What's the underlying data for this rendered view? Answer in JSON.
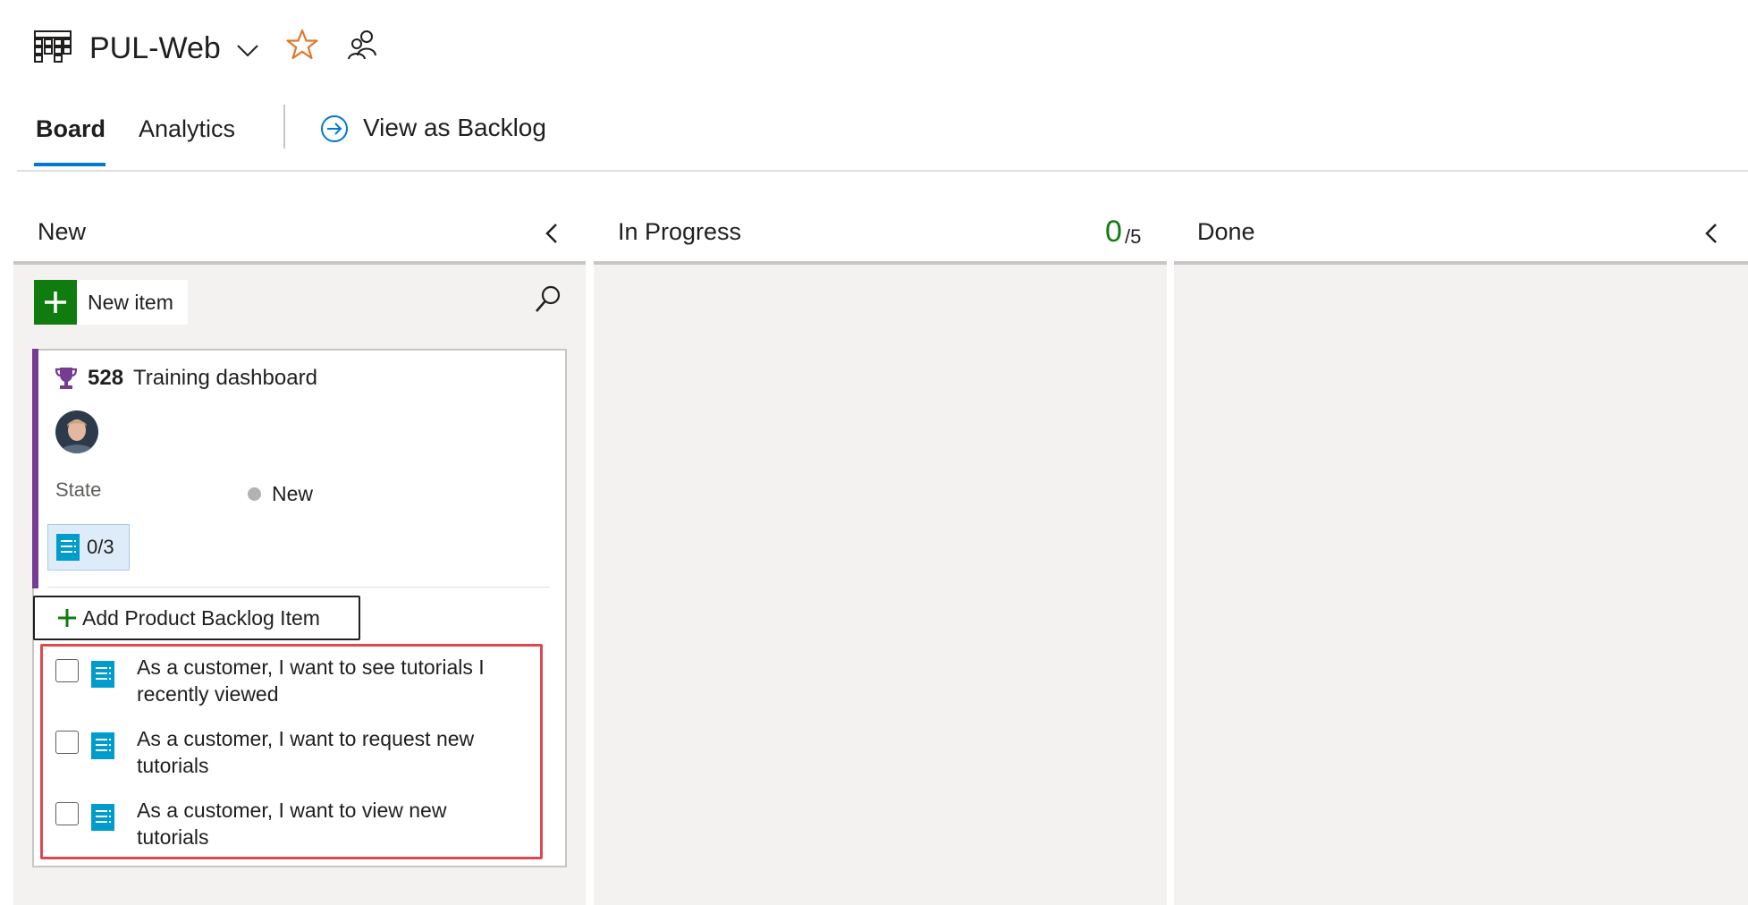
{
  "header": {
    "project_title": "PUL-Web",
    "icons": [
      "board-icon",
      "chevron-down-icon",
      "star-icon",
      "people-icon"
    ],
    "star_color": "#e1782c"
  },
  "tabs": {
    "board": "Board",
    "analytics": "Analytics",
    "view_backlog": "View as Backlog",
    "active_color": "#0078d4"
  },
  "columns": {
    "new": {
      "title": "New"
    },
    "in_progress": {
      "title": "In Progress",
      "wip_count": "0",
      "wip_limit": "/5"
    },
    "done": {
      "title": "Done"
    }
  },
  "new_item_button": {
    "label": "New item"
  },
  "card": {
    "id": "528",
    "title": "Training dashboard",
    "type_icon": "trophy-icon",
    "accent_color": "#773b93",
    "state_label": "State",
    "state_value": "New",
    "child_progress": "0/3",
    "add_child_label": "Add Product Backlog Item",
    "children": [
      {
        "text": "As a customer, I want to see tutorials I recently viewed"
      },
      {
        "text": "As a customer, I want to request new tutorials"
      },
      {
        "text": "As a customer, I want to view new tutorials"
      }
    ]
  }
}
